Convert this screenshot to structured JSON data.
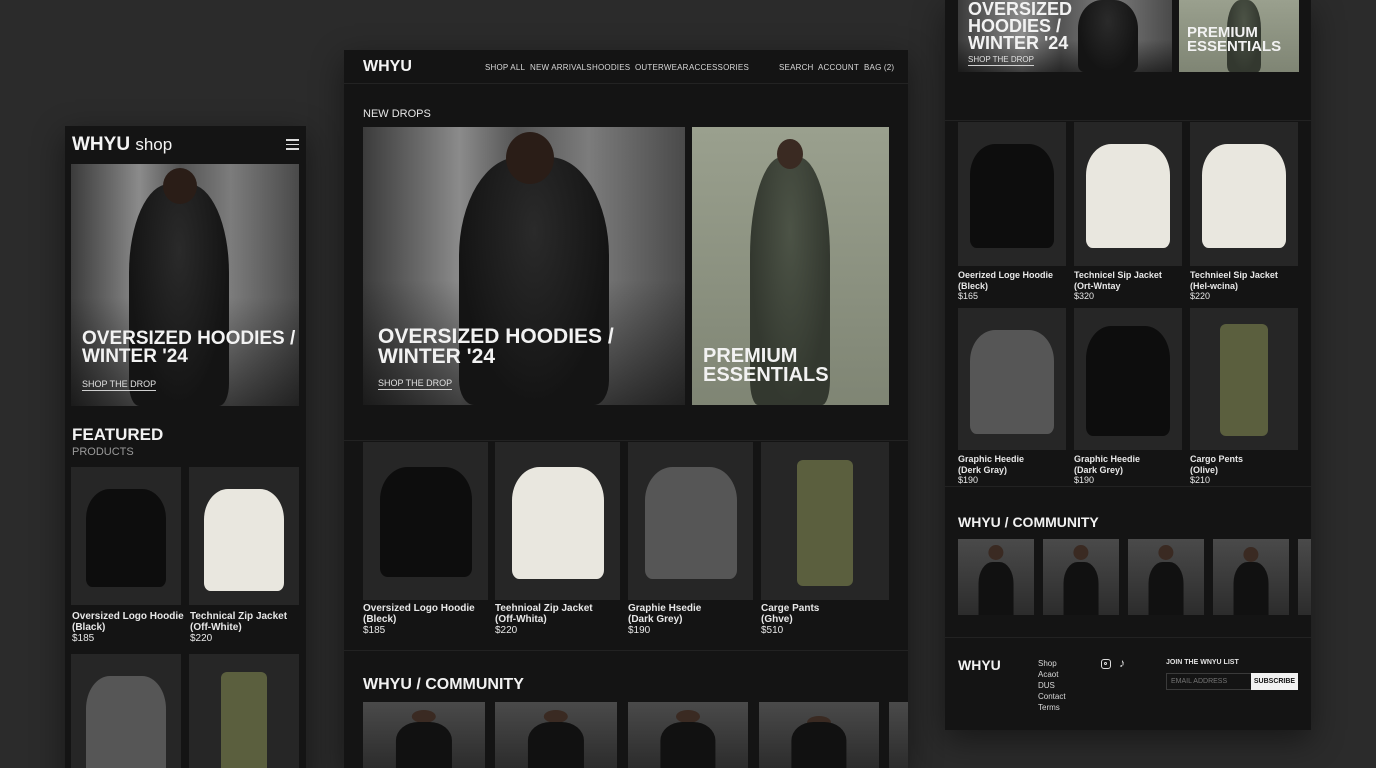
{
  "mobile": {
    "logo": "WHYU",
    "logo_suffix": "shop",
    "hero": {
      "title_line1": "OVERSIZED HOODIES /",
      "title_line2": "WINTER '24",
      "link": "SHOP THE DROP"
    },
    "featured": {
      "title": "FEATURED",
      "subtitle": "PRODUCTS"
    },
    "products": [
      {
        "name_line1": "Oversized Logo Hoodie",
        "name_line2": "(Black)",
        "price": "$185"
      },
      {
        "name_line1": "Technical Zip Jacket",
        "name_line2": "(Off-White)",
        "price": "$220"
      }
    ]
  },
  "desktop": {
    "logo": "WHYU",
    "nav": [
      "SHOP ALL",
      "NEW ARRIVALS",
      "HOODIES",
      "OUTERWEAR",
      "ACCESSORIES"
    ],
    "utility": [
      "SEARCH",
      "ACCOUNT",
      "BAG (2)"
    ],
    "section_label": "NEW DROPS",
    "hero": {
      "title_line1": "OVERSIZED HOODIES /",
      "title_line2": "WINTER '24",
      "link": "SHOP THE DROP"
    },
    "hero2": {
      "title_line1": "PREMIUM",
      "title_line2": "ESSENTIALS"
    },
    "products": [
      {
        "name_line1": "Oversized Logo Hoodie",
        "name_line2": "(Bleck)",
        "price": "$185"
      },
      {
        "name_line1": "Teehnioal Zip Jacket",
        "name_line2": "(Off-Whita)",
        "price": "$220"
      },
      {
        "name_line1": "Graphie Hsedie",
        "name_line2": "(Dark Grey)",
        "price": "$190"
      },
      {
        "name_line1": "Carge Pants",
        "name_line2": "(Ghve)",
        "price": "$510"
      }
    ],
    "community_title": "WHYU / COMMUNITY"
  },
  "right": {
    "hero": {
      "title_line1": "OVERSIZED",
      "title_line2": "HOODIES /",
      "title_line3": "WINTER '24",
      "link": "SHOP THE DROP"
    },
    "hero2": {
      "title_line1": "PREMIUM",
      "title_line2": "ESSENTIALS"
    },
    "products": [
      {
        "name_line1": "Oeerized Loge Hoodie",
        "name_line2": "(Bleck)",
        "price": "$165"
      },
      {
        "name_line1": "Technicel Sip Jacket",
        "name_line2": "(Ort-Wntay",
        "price": "$320"
      },
      {
        "name_line1": "Technieel Sip Jacket",
        "name_line2": "(Hel-wcina)",
        "price": "$220"
      },
      {
        "name_line1": "Graphic Heedie",
        "name_line2": "(Derk Gray)",
        "price": "$190"
      },
      {
        "name_line1": "Graphic Heedie",
        "name_line2": "(Dark Grey)",
        "price": "$190"
      },
      {
        "name_line1": "Cargo Pents",
        "name_line2": "(Olive)",
        "price": "$210"
      }
    ],
    "community_title": "WHYU / COMMUNITY",
    "footer": {
      "logo": "WHYU",
      "links": [
        "Shop",
        "Acaot",
        "DUS",
        "Contact",
        "Terms"
      ],
      "newsletter_title": "JOIN THE WNYU LIST",
      "email_placeholder": "EMAIL ADDRESS",
      "subscribe": "SUBSCRIBE"
    }
  }
}
